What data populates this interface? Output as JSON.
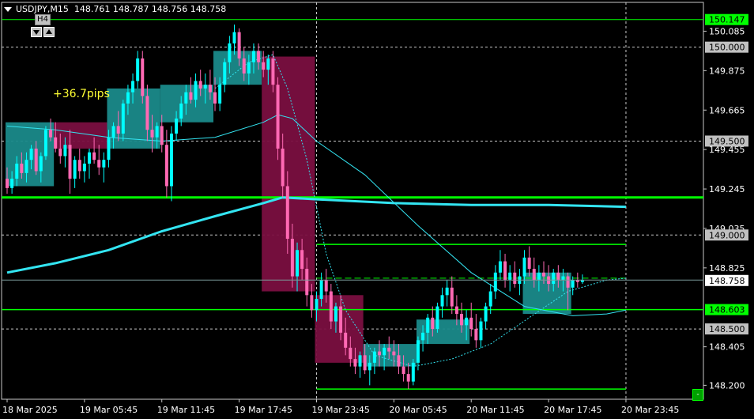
{
  "header": {
    "symbol": "USDJPY,M15",
    "ohlc": "148.761 148.787 148.756 148.758",
    "timeframe_button": "H4",
    "annotation": "+36.7pips",
    "corner_button": "-"
  },
  "colors": {
    "background": "#000000",
    "bull": "#00ffff",
    "bear": "#ff69b4",
    "bull_box": "#1a8a8a",
    "bear_box": "#7a0f40",
    "levels": "#00ff00",
    "ma": "#33e5f2",
    "grid": "#c8c8c8",
    "text": "#ffffff"
  },
  "chart_data": {
    "type": "candlestick",
    "symbol": "USDJPY",
    "timeframe": "M15",
    "ylim": [
      148.13,
      150.23
    ],
    "time_axis_labels": [
      "18 Mar 2025",
      "19 Mar 05:45",
      "19 Mar 11:45",
      "19 Mar 17:45",
      "19 Mar 23:45",
      "20 Mar 05:45",
      "20 Mar 11:45",
      "20 Mar 17:45",
      "20 Mar 23:45"
    ],
    "price_ticks": [
      "150.085",
      "149.875",
      "149.665",
      "149.455",
      "149.245",
      "149.035",
      "148.825",
      "148.405",
      "148.200"
    ],
    "price_tags": [
      {
        "value": 150.147,
        "label": "150.147",
        "style": "green"
      },
      {
        "value": 150.0,
        "label": "150.000",
        "style": "gray"
      },
      {
        "value": 149.5,
        "label": "149.500",
        "style": "gray"
      },
      {
        "value": 149.0,
        "label": "149.000",
        "style": "gray"
      },
      {
        "value": 148.758,
        "label": "148.758",
        "style": "white"
      },
      {
        "value": 148.603,
        "label": "148.603",
        "style": "green"
      },
      {
        "value": 148.5,
        "label": "148.500",
        "style": "gray"
      }
    ],
    "horizontal_lines": [
      {
        "price": 150.147,
        "from": 0,
        "to": 144,
        "style": "thin"
      },
      {
        "price": 149.2,
        "from": 0,
        "to": 144,
        "style": "thick"
      },
      {
        "price": 148.603,
        "from": 0,
        "to": 144,
        "style": "medium"
      },
      {
        "price": 148.95,
        "from": 64,
        "to": 128,
        "style": "medium"
      },
      {
        "price": 148.18,
        "from": 64,
        "to": 128,
        "style": "medium"
      },
      {
        "price": 148.77,
        "from": 64,
        "to": 128,
        "style": "dashed"
      }
    ],
    "grid_levels": [
      150.0,
      149.5,
      149.0,
      148.5
    ],
    "vertical_dashed_at_bar": [
      64,
      128
    ],
    "boxes": [
      {
        "from": 0,
        "to": 10,
        "top": 149.6,
        "bottom": 149.26,
        "kind": "bull"
      },
      {
        "from": 10,
        "to": 21,
        "top": 149.6,
        "bottom": 149.46,
        "kind": "bear"
      },
      {
        "from": 21,
        "to": 32,
        "top": 149.78,
        "bottom": 149.46,
        "kind": "bull"
      },
      {
        "from": 32,
        "to": 43,
        "top": 149.8,
        "bottom": 149.6,
        "kind": "bull"
      },
      {
        "from": 43,
        "to": 53,
        "top": 149.98,
        "bottom": 149.8,
        "kind": "bull"
      },
      {
        "from": 53,
        "to": 64,
        "top": 149.95,
        "bottom": 148.7,
        "kind": "bear"
      },
      {
        "from": 64,
        "to": 74,
        "top": 148.68,
        "bottom": 148.32,
        "kind": "bear"
      },
      {
        "from": 74,
        "to": 85,
        "top": 148.42,
        "bottom": 148.3,
        "kind": "bull"
      },
      {
        "from": 85,
        "to": 96,
        "top": 148.55,
        "bottom": 148.42,
        "kind": "bull"
      },
      {
        "from": 107,
        "to": 117,
        "top": 148.8,
        "bottom": 148.58,
        "kind": "bull"
      }
    ],
    "ma_fast": [
      [
        0,
        149.58
      ],
      [
        10,
        149.56
      ],
      [
        21,
        149.52
      ],
      [
        32,
        149.5
      ],
      [
        43,
        149.52
      ],
      [
        53,
        149.6
      ],
      [
        56,
        149.64
      ],
      [
        59,
        149.62
      ],
      [
        64,
        149.5
      ],
      [
        74,
        149.32
      ],
      [
        85,
        149.05
      ],
      [
        96,
        148.8
      ],
      [
        107,
        148.62
      ],
      [
        117,
        148.57
      ],
      [
        124,
        148.58
      ],
      [
        128,
        148.6
      ]
    ],
    "ma_slow": [
      [
        0,
        148.8
      ],
      [
        10,
        148.85
      ],
      [
        21,
        148.92
      ],
      [
        32,
        149.02
      ],
      [
        43,
        149.1
      ],
      [
        53,
        149.17
      ],
      [
        57,
        149.2
      ],
      [
        64,
        149.19
      ],
      [
        80,
        149.17
      ],
      [
        96,
        149.16
      ],
      [
        112,
        149.16
      ],
      [
        128,
        149.15
      ]
    ],
    "ma_dotted": [
      [
        43,
        149.78
      ],
      [
        50,
        149.92
      ],
      [
        55,
        149.96
      ],
      [
        58,
        149.78
      ],
      [
        62,
        149.4
      ],
      [
        66,
        148.9
      ],
      [
        70,
        148.6
      ],
      [
        76,
        148.36
      ],
      [
        84,
        148.3
      ],
      [
        92,
        148.34
      ],
      [
        100,
        148.42
      ],
      [
        108,
        148.56
      ],
      [
        116,
        148.7
      ],
      [
        124,
        148.76
      ],
      [
        128,
        148.77
      ]
    ],
    "candles": [
      [
        149.3,
        149.36,
        149.22,
        149.25
      ],
      [
        149.25,
        149.34,
        149.22,
        149.3
      ],
      [
        149.3,
        149.42,
        149.26,
        149.38
      ],
      [
        149.38,
        149.44,
        149.3,
        149.33
      ],
      [
        149.33,
        149.44,
        149.28,
        149.4
      ],
      [
        149.4,
        149.48,
        149.35,
        149.46
      ],
      [
        149.46,
        149.5,
        149.32,
        149.34
      ],
      [
        149.34,
        149.44,
        149.28,
        149.42
      ],
      [
        149.42,
        149.58,
        149.4,
        149.56
      ],
      [
        149.56,
        149.62,
        149.5,
        149.52
      ],
      [
        149.52,
        149.6,
        149.44,
        149.46
      ],
      [
        149.46,
        149.54,
        149.38,
        149.42
      ],
      [
        149.42,
        149.52,
        149.36,
        149.48
      ],
      [
        149.48,
        149.56,
        149.22,
        149.3
      ],
      [
        149.3,
        149.42,
        149.25,
        149.4
      ],
      [
        149.4,
        149.46,
        149.3,
        149.34
      ],
      [
        149.34,
        149.42,
        149.28,
        149.38
      ],
      [
        149.38,
        149.46,
        149.3,
        149.44
      ],
      [
        149.44,
        149.52,
        149.38,
        149.4
      ],
      [
        149.4,
        149.48,
        149.32,
        149.36
      ],
      [
        149.36,
        149.44,
        149.28,
        149.4
      ],
      [
        149.4,
        149.56,
        149.36,
        149.52
      ],
      [
        149.52,
        149.6,
        149.46,
        149.58
      ],
      [
        149.58,
        149.66,
        149.5,
        149.54
      ],
      [
        149.54,
        149.72,
        149.5,
        149.7
      ],
      [
        149.7,
        149.8,
        149.64,
        149.76
      ],
      [
        149.76,
        149.86,
        149.7,
        149.82
      ],
      [
        149.82,
        149.98,
        149.78,
        149.94
      ],
      [
        149.94,
        149.98,
        149.7,
        149.74
      ],
      [
        149.74,
        149.8,
        149.5,
        149.56
      ],
      [
        149.56,
        149.64,
        149.44,
        149.52
      ],
      [
        149.52,
        149.6,
        149.46,
        149.58
      ],
      [
        149.58,
        149.64,
        149.44,
        149.48
      ],
      [
        149.48,
        149.56,
        149.2,
        149.26
      ],
      [
        149.26,
        149.58,
        149.18,
        149.54
      ],
      [
        149.54,
        149.66,
        149.5,
        149.62
      ],
      [
        149.62,
        149.74,
        149.58,
        149.7
      ],
      [
        149.7,
        149.8,
        149.64,
        149.76
      ],
      [
        149.76,
        149.84,
        149.7,
        149.72
      ],
      [
        149.72,
        149.86,
        149.68,
        149.82
      ],
      [
        149.82,
        149.88,
        149.74,
        149.78
      ],
      [
        149.78,
        149.86,
        149.7,
        149.8
      ],
      [
        149.8,
        149.88,
        149.72,
        149.76
      ],
      [
        149.76,
        149.84,
        149.66,
        149.7
      ],
      [
        149.7,
        149.84,
        149.66,
        149.8
      ],
      [
        149.8,
        149.94,
        149.76,
        149.92
      ],
      [
        149.92,
        150.06,
        149.86,
        150.02
      ],
      [
        150.02,
        150.12,
        149.96,
        150.08
      ],
      [
        150.08,
        150.1,
        149.9,
        149.94
      ],
      [
        149.94,
        150.0,
        149.82,
        149.86
      ],
      [
        149.86,
        149.96,
        149.8,
        149.92
      ],
      [
        149.92,
        150.02,
        149.86,
        149.98
      ],
      [
        149.98,
        150.02,
        149.88,
        149.92
      ],
      [
        149.92,
        149.98,
        149.84,
        149.88
      ],
      [
        149.88,
        149.96,
        149.8,
        149.94
      ],
      [
        149.94,
        149.98,
        149.76,
        149.8
      ],
      [
        149.8,
        149.84,
        149.4,
        149.46
      ],
      [
        149.46,
        149.54,
        149.2,
        149.26
      ],
      [
        149.26,
        149.34,
        148.9,
        148.98
      ],
      [
        148.98,
        149.06,
        148.72,
        148.78
      ],
      [
        148.78,
        148.96,
        148.7,
        148.92
      ],
      [
        148.92,
        148.98,
        148.76,
        148.82
      ],
      [
        148.82,
        148.88,
        148.62,
        148.68
      ],
      [
        148.68,
        148.74,
        148.56,
        148.6
      ],
      [
        148.6,
        148.7,
        148.54,
        148.66
      ],
      [
        148.66,
        148.8,
        148.62,
        148.76
      ],
      [
        148.76,
        148.82,
        148.64,
        148.7
      ],
      [
        148.7,
        148.74,
        148.5,
        148.54
      ],
      [
        148.54,
        148.64,
        148.48,
        148.62
      ],
      [
        148.62,
        148.68,
        148.44,
        148.48
      ],
      [
        148.48,
        148.56,
        148.36,
        148.4
      ],
      [
        148.4,
        148.46,
        148.3,
        148.34
      ],
      [
        148.34,
        148.4,
        148.26,
        148.3
      ],
      [
        148.3,
        148.38,
        148.24,
        148.36
      ],
      [
        148.36,
        148.42,
        148.26,
        148.28
      ],
      [
        148.28,
        148.36,
        148.2,
        148.32
      ],
      [
        148.32,
        148.4,
        148.26,
        148.38
      ],
      [
        148.38,
        148.44,
        148.3,
        148.36
      ],
      [
        148.36,
        148.42,
        148.28,
        148.4
      ],
      [
        148.4,
        148.46,
        148.34,
        148.38
      ],
      [
        148.38,
        148.44,
        148.3,
        148.36
      ],
      [
        148.36,
        148.42,
        148.26,
        148.3
      ],
      [
        148.3,
        148.36,
        148.22,
        148.26
      ],
      [
        148.26,
        148.32,
        148.18,
        148.22
      ],
      [
        148.22,
        148.34,
        148.2,
        148.32
      ],
      [
        148.32,
        148.46,
        148.28,
        148.44
      ],
      [
        148.44,
        148.52,
        148.38,
        148.48
      ],
      [
        148.48,
        148.58,
        148.42,
        148.56
      ],
      [
        148.56,
        148.62,
        148.46,
        148.5
      ],
      [
        148.5,
        148.64,
        148.48,
        148.62
      ],
      [
        148.62,
        148.72,
        148.56,
        148.68
      ],
      [
        148.68,
        148.76,
        148.62,
        148.72
      ],
      [
        148.72,
        148.78,
        148.58,
        148.62
      ],
      [
        148.62,
        148.68,
        148.52,
        148.58
      ],
      [
        148.58,
        148.64,
        148.48,
        148.52
      ],
      [
        148.52,
        148.6,
        148.44,
        148.56
      ],
      [
        148.56,
        148.64,
        148.46,
        148.5
      ],
      [
        148.5,
        148.58,
        148.4,
        148.44
      ],
      [
        148.44,
        148.56,
        148.4,
        148.54
      ],
      [
        148.54,
        148.64,
        148.5,
        148.62
      ],
      [
        148.62,
        148.74,
        148.58,
        148.7
      ],
      [
        148.7,
        148.84,
        148.66,
        148.8
      ],
      [
        148.8,
        148.92,
        148.76,
        148.86
      ],
      [
        148.86,
        148.9,
        148.72,
        148.76
      ],
      [
        148.76,
        148.84,
        148.7,
        148.8
      ],
      [
        148.8,
        148.86,
        148.72,
        148.74
      ],
      [
        148.74,
        148.82,
        148.68,
        148.78
      ],
      [
        148.78,
        148.92,
        148.74,
        148.88
      ],
      [
        148.88,
        148.94,
        148.78,
        148.82
      ],
      [
        148.82,
        148.88,
        148.72,
        148.76
      ],
      [
        148.76,
        148.84,
        148.7,
        148.8
      ],
      [
        148.8,
        148.86,
        148.74,
        148.78
      ],
      [
        148.78,
        148.84,
        148.7,
        148.74
      ],
      [
        148.74,
        148.82,
        148.7,
        148.8
      ],
      [
        148.8,
        148.84,
        148.72,
        148.76
      ],
      [
        148.76,
        148.82,
        148.7,
        148.78
      ],
      [
        148.78,
        148.8,
        148.6,
        148.72
      ],
      [
        148.72,
        148.78,
        148.68,
        148.76
      ],
      [
        148.76,
        148.8,
        148.72,
        148.75
      ],
      [
        148.75,
        148.79,
        148.74,
        148.76
      ]
    ]
  }
}
